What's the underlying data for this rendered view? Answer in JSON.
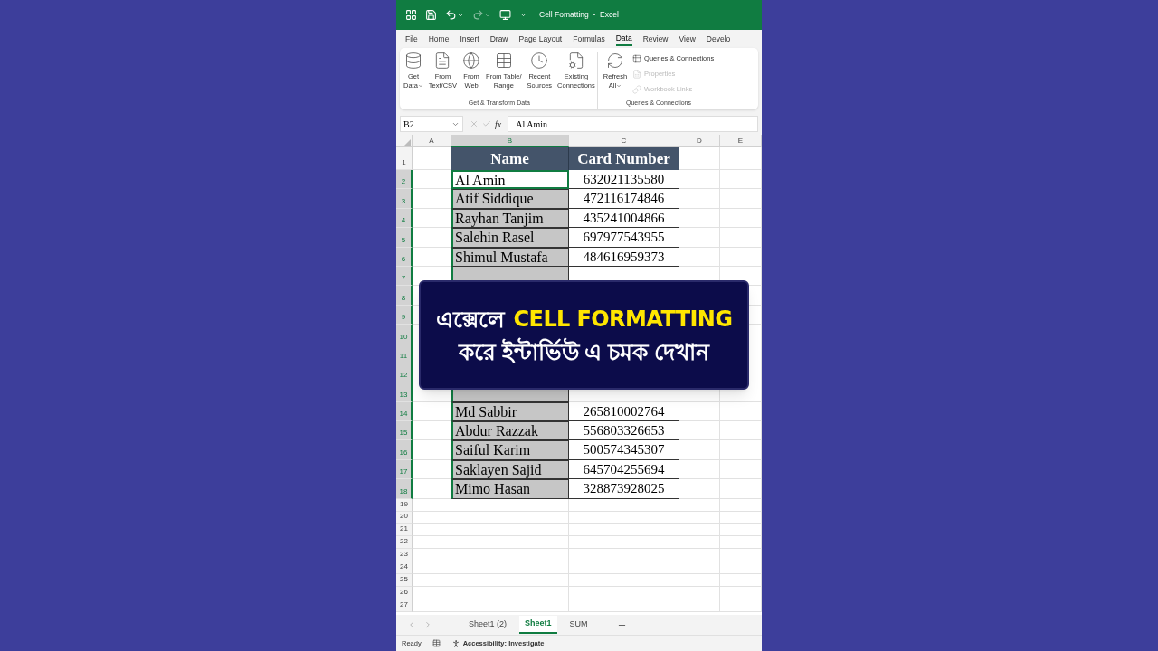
{
  "window": {
    "title": "Cell Fomatting  -  Excel"
  },
  "ribbon_tabs": [
    {
      "label": "File",
      "selected": false
    },
    {
      "label": "Home",
      "selected": false
    },
    {
      "label": "Insert",
      "selected": false
    },
    {
      "label": "Draw",
      "selected": false
    },
    {
      "label": "Page Layout",
      "selected": false
    },
    {
      "label": "Formulas",
      "selected": false
    },
    {
      "label": "Data",
      "selected": true
    },
    {
      "label": "Review",
      "selected": false
    },
    {
      "label": "View",
      "selected": false
    },
    {
      "label": "Develo",
      "selected": false
    }
  ],
  "ribbon_groups": [
    {
      "label": "Get & Transform Data",
      "buttons": [
        {
          "kind": "database",
          "lines": [
            "Get",
            "Data"
          ],
          "dropdown": true
        },
        {
          "kind": "text-file",
          "lines": [
            "From",
            "Text/CSV"
          ],
          "dropdown": false
        },
        {
          "kind": "web",
          "lines": [
            "From",
            "Web"
          ],
          "dropdown": false
        },
        {
          "kind": "table",
          "lines": [
            "From Table/",
            "Range"
          ],
          "dropdown": false
        },
        {
          "kind": "recent",
          "lines": [
            "Recent",
            "Sources"
          ],
          "dropdown": false
        },
        {
          "kind": "connections",
          "lines": [
            "Existing",
            "Connections"
          ],
          "dropdown": false
        }
      ]
    },
    {
      "label": "Queries & Connections",
      "buttons": [
        {
          "kind": "refresh",
          "lines": [
            "Refresh",
            "All"
          ],
          "dropdown": true
        }
      ],
      "small_buttons": [
        {
          "label": "Queries & Connections",
          "disabled": false
        },
        {
          "label": "Properties",
          "disabled": true
        },
        {
          "label": "Workbook Links",
          "disabled": true
        }
      ]
    }
  ],
  "name_box": "B2",
  "function_label": "fx",
  "formula": "Al Amin",
  "column_headers": [
    {
      "label": "A",
      "selected": false
    },
    {
      "label": "B",
      "selected": true
    },
    {
      "label": "C",
      "selected": false
    },
    {
      "label": "D",
      "selected": false
    },
    {
      "label": "E",
      "selected": false
    }
  ],
  "row_headers": [
    {
      "label": "1",
      "selected": false
    },
    {
      "label": "2",
      "selected": true
    },
    {
      "label": "3",
      "selected": true
    },
    {
      "label": "4",
      "selected": true
    },
    {
      "label": "5",
      "selected": true
    },
    {
      "label": "6",
      "selected": true
    },
    {
      "label": "7",
      "selected": true
    },
    {
      "label": "8",
      "selected": true
    },
    {
      "label": "9",
      "selected": true
    },
    {
      "label": "10",
      "selected": true
    },
    {
      "label": "11",
      "selected": true
    },
    {
      "label": "12",
      "selected": true
    },
    {
      "label": "13",
      "selected": true
    },
    {
      "label": "14",
      "selected": true
    },
    {
      "label": "15",
      "selected": true
    },
    {
      "label": "16",
      "selected": true
    },
    {
      "label": "17",
      "selected": true
    },
    {
      "label": "18",
      "selected": true
    },
    {
      "label": "19",
      "selected": false
    },
    {
      "label": "20",
      "selected": false
    },
    {
      "label": "21",
      "selected": false
    },
    {
      "label": "22",
      "selected": false
    },
    {
      "label": "23",
      "selected": false
    },
    {
      "label": "24",
      "selected": false
    },
    {
      "label": "25",
      "selected": false
    },
    {
      "label": "26",
      "selected": false
    },
    {
      "label": "27",
      "selected": false
    }
  ],
  "table": {
    "columns": [
      "Name",
      "Card Number"
    ],
    "upper_rows": [
      {
        "name": "Al Amin",
        "card": "632021135580",
        "selected": true,
        "active": true
      },
      {
        "name": "Atif Siddique",
        "card": "472116174846",
        "selected": true,
        "active": false
      },
      {
        "name": "Rayhan Tanjim",
        "card": "435241004866",
        "selected": true,
        "active": false
      },
      {
        "name": "Salehin Rasel",
        "card": "697977543955",
        "selected": true,
        "active": false
      },
      {
        "name": "Shimul Mustafa",
        "card": "484616959373",
        "selected": true,
        "active": false
      }
    ],
    "lower_rows": [
      {
        "name": "Md Sabbir",
        "card": "265810002764",
        "selected": true,
        "active": false
      },
      {
        "name": "Abdur Razzak",
        "card": "556803326653",
        "selected": true,
        "active": false
      },
      {
        "name": "Saiful Karim",
        "card": "500574345307",
        "selected": true,
        "active": false
      },
      {
        "name": "Saklayen Sajid",
        "card": "645704255694",
        "selected": true,
        "active": false
      },
      {
        "name": "Mimo Hasan",
        "card": "328873928025",
        "selected": true,
        "active": false
      }
    ]
  },
  "banner": {
    "line1": "এক্সেলে",
    "highlight": "CELL FORMATTING",
    "line2": "করে ইন্টার্ভিউ এ চমক দেখান"
  },
  "sheet_tabs": [
    {
      "label": "Sheet1 (2)",
      "selected": false
    },
    {
      "label": "Sheet1",
      "selected": true
    },
    {
      "label": "SUM",
      "selected": false
    }
  ],
  "status_bar": {
    "mode": "Ready",
    "accessibility": "Accessibility: Investigate"
  }
}
